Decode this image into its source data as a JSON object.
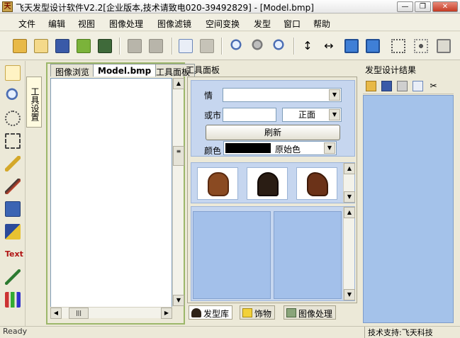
{
  "window": {
    "title": "飞天发型设计软件V2.2[企业版本,技术请致电020-39492829] - [Model.bmp]",
    "icon_text": "天",
    "minimize_glyph": "—",
    "restore_glyph": "❐",
    "close_glyph": "✕"
  },
  "menu": {
    "items": [
      {
        "label": "文件"
      },
      {
        "label": "编辑"
      },
      {
        "label": "视图"
      },
      {
        "label": "图像处理"
      },
      {
        "label": "图像滤镜"
      },
      {
        "label": "空间变换"
      },
      {
        "label": "发型"
      },
      {
        "label": "窗口"
      },
      {
        "label": "帮助"
      }
    ]
  },
  "toolbar": {
    "icons": [
      "open-folder",
      "open-file",
      "save",
      "export",
      "camera",
      "undo",
      "redo",
      "copy",
      "paste",
      "zoom-in",
      "zoom-pan",
      "zoom-out",
      "flip-vertical",
      "flip-horizontal",
      "rotate-left",
      "rotate-right",
      "select-marquee",
      "select-ellipse",
      "fit-screen"
    ]
  },
  "left_tools": {
    "icons": [
      "hand",
      "zoom",
      "lasso",
      "rect-select",
      "brush",
      "pencil",
      "fill",
      "eraser",
      "text",
      "eyedropper",
      "levels"
    ],
    "vertical_tab": "工具设置"
  },
  "document": {
    "tabs": [
      {
        "label": "图像浏览"
      },
      {
        "label": "Model.bmp"
      },
      {
        "label": "工具面板"
      }
    ]
  },
  "tool_panel": {
    "label": "工具面板",
    "row1_label": "情",
    "row1_value": "",
    "row2_label": "或市",
    "row2_value": "",
    "row2_right_value": "正面",
    "refresh_label": "刷新",
    "color_label": "颜色",
    "color_swatch": "#000000",
    "color_value": "原始色",
    "bottom_tabs": [
      {
        "label": "发型库"
      },
      {
        "label": "饰物"
      },
      {
        "label": "图像处理"
      }
    ]
  },
  "right_panel": {
    "label": "发型设计结果",
    "bg_color": "#a4c2ea"
  },
  "status": {
    "text": "Ready",
    "support": "技术支持:飞天科技"
  },
  "colors": {
    "chrome": "#ece9d8",
    "panel_blue": "#c6d6ef",
    "slot_blue": "#a3c0ea",
    "green_border": "#9cb76a"
  }
}
